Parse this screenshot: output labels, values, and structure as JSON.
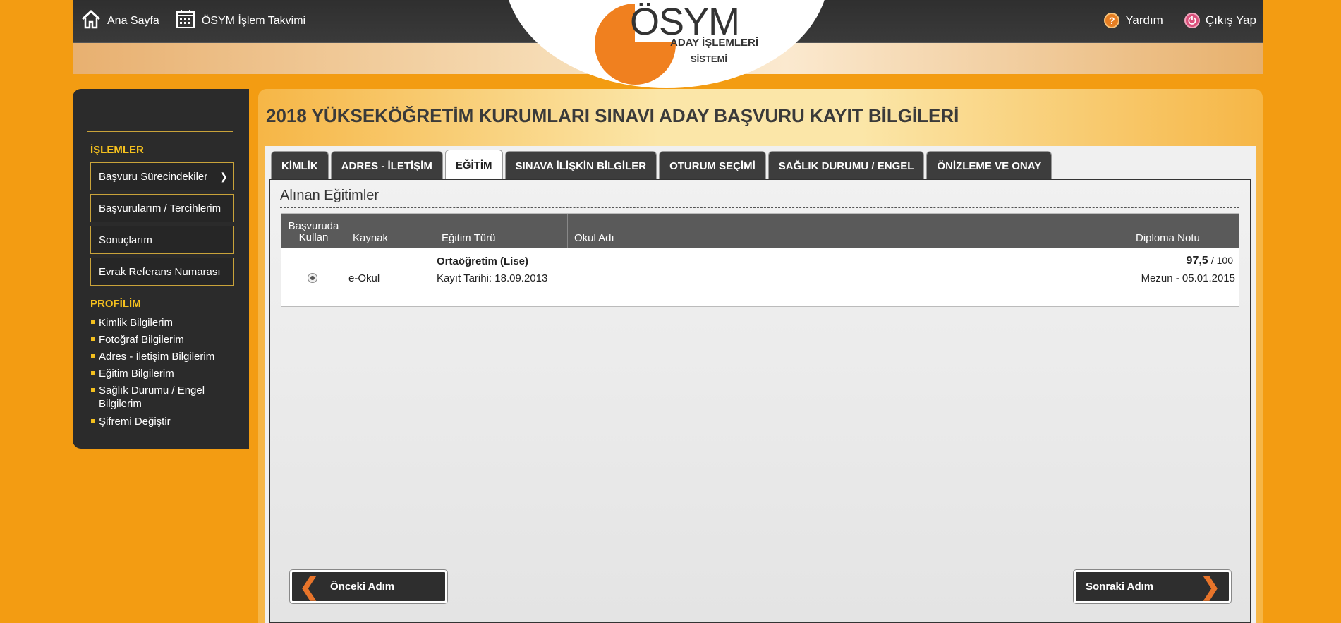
{
  "topnav": {
    "home_label": "Ana Sayfa",
    "calendar_label": "ÖSYM İşlem Takvimi",
    "help_label": "Yardım",
    "exit_label": "Çıkış Yap"
  },
  "logo": {
    "name": "ÖSYM",
    "line1": "ADAY İŞLEMLERİ",
    "line2": "SİSTEMİ"
  },
  "sidebar": {
    "section1": "İŞLEMLER",
    "buttons": [
      "Başvuru Sürecindekiler",
      "Başvurularım / Tercihlerim",
      "Sonuçlarım",
      "Evrak Referans Numarası"
    ],
    "section2": "PROFİLİM",
    "links": [
      "Kimlik Bilgilerim",
      "Fotoğraf Bilgilerim",
      "Adres - İletişim Bilgilerim",
      "Eğitim Bilgilerim",
      "Sağlık Durumu / Engel Bilgilerim",
      "Şifremi Değiştir"
    ]
  },
  "page": {
    "title": "2018 YÜKSEKÖĞRETİM KURUMLARI SINAVI ADAY BAŞVURU KAYIT BİLGİLERİ"
  },
  "tabs": [
    "KİMLİK",
    "ADRES - İLETİŞİM",
    "EĞİTİM",
    "SINAVA İLİŞKİN BİLGİLER",
    "OTURUM SEÇİMİ",
    "SAĞLIK DURUMU / ENGEL",
    "ÖNİZLEME VE ONAY"
  ],
  "active_tab": "EĞİTİM",
  "section": {
    "title": "Alınan Eğitimler"
  },
  "table": {
    "headers": {
      "use_line1": "Başvuruda",
      "use_line2": "Kullan",
      "source": "Kaynak",
      "type": "Eğitim Türü",
      "school": "Okul Adı",
      "grade": "Diploma Notu"
    },
    "rows": [
      {
        "source": "e-Okul",
        "type": "Ortaöğretim (Lise)",
        "registration": "Kayıt Tarihi: 18.09.2013",
        "school": "",
        "grade": "97,5",
        "grade_max": "/ 100",
        "graduation": "Mezun - 05.01.2015",
        "selected": true
      }
    ]
  },
  "buttons": {
    "prev": "Önceki Adım",
    "next": "Sonraki Adım"
  },
  "colors": {
    "background": "#f39c12",
    "accent": "#f4c01e",
    "dark": "#2b2b2b",
    "logo_orange": "#f0801f"
  }
}
